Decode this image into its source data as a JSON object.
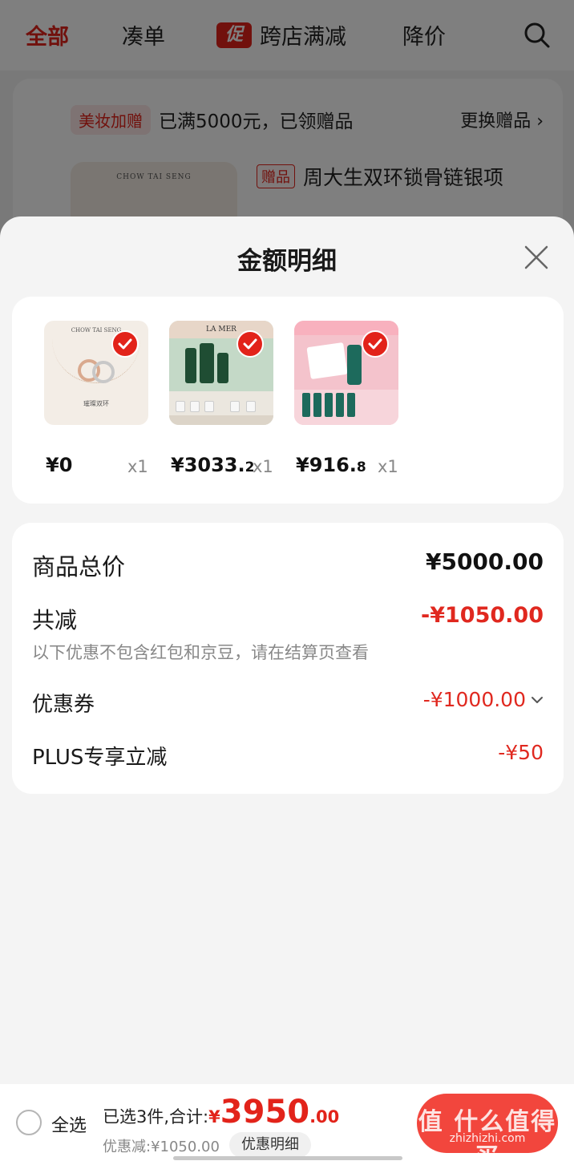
{
  "top_nav": {
    "tabs": [
      {
        "label": "全部",
        "active": true
      },
      {
        "label": "凑单",
        "active": false
      },
      {
        "label": "跨店满减",
        "badge": "促",
        "active": false
      },
      {
        "label": "降价",
        "active": false
      }
    ],
    "search_icon": "search-icon"
  },
  "background_card": {
    "gift_tag": "美妆加赠",
    "gift_status": "已满5000元，已领赠品",
    "gift_change": "更换赠品 ›",
    "gift_item_tag": "赠品",
    "gift_item_name": "周大生双环锁骨链银项",
    "thumb_brand": "CHOW TAI SENG"
  },
  "sheet": {
    "title": "金额明细",
    "close_icon": "close-icon",
    "products": [
      {
        "price": "¥0",
        "price_decimal": "",
        "qty": "x1",
        "brand": "CHOW TAI SENG",
        "caption": "璀璨双环"
      },
      {
        "price": "¥3033.",
        "price_decimal": "2",
        "qty": "x1",
        "brand": "LA MER"
      },
      {
        "price": "¥916.",
        "price_decimal": "8",
        "qty": "x1"
      }
    ],
    "details": {
      "total_label": "商品总价",
      "total_value": "¥5000.00",
      "discount_label": "共减",
      "discount_value": "-¥1050.00",
      "discount_note": "以下优惠不包含红包和京豆，请在结算页查看",
      "coupon_label": "优惠券",
      "coupon_value": "-¥1000.00",
      "plus_label": "PLUS专享立减",
      "plus_value": "-¥50"
    }
  },
  "bottom_bar": {
    "select_all": "全选",
    "selected_text": "已选3件,合计:",
    "currency": "¥",
    "total_integer": "3950",
    "total_decimal": ".00",
    "discount_text": "优惠减:¥1050.00",
    "detail_button": "优惠明细",
    "watermark": "值 什么值得买",
    "watermark_url": "zhizhizhi.com"
  },
  "colors": {
    "accent": "#e2231a",
    "price_red": "#e0281f",
    "checkout": "#f2463d"
  }
}
